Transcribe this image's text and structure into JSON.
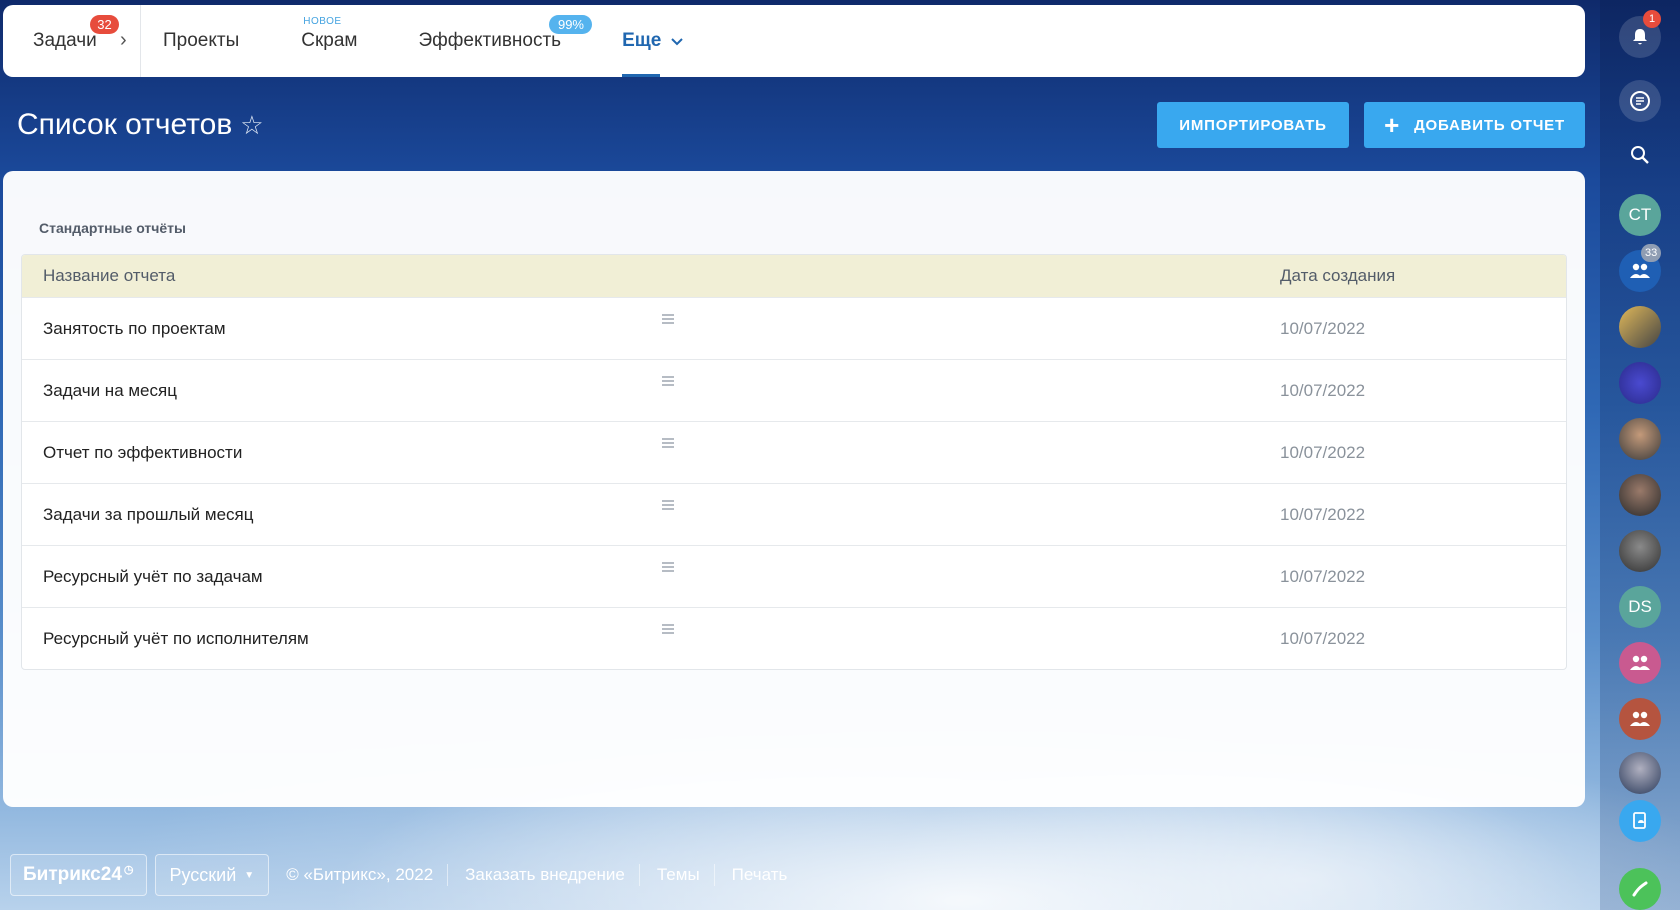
{
  "nav": {
    "tasks": {
      "label": "Задачи",
      "badge": "32"
    },
    "projects": {
      "label": "Проекты"
    },
    "scrum": {
      "label": "Скрам",
      "tag": "НОВОЕ"
    },
    "efficiency": {
      "label": "Эффективность",
      "badge": "99%"
    },
    "more": {
      "label": "Еще"
    }
  },
  "page": {
    "title": "Список отчетов",
    "import_label": "ИМПОРТИРОВАТЬ",
    "add_label": "ДОБАВИТЬ ОТЧЕТ"
  },
  "reports": {
    "section_title": "Стандартные отчёты",
    "columns": {
      "name": "Название отчета",
      "date": "Дата создания"
    },
    "rows": [
      {
        "name": "Занятость по проектам",
        "date": "10/07/2022"
      },
      {
        "name": "Задачи на месяц",
        "date": "10/07/2022"
      },
      {
        "name": "Отчет по эффективности",
        "date": "10/07/2022"
      },
      {
        "name": "Задачи за прошлый месяц",
        "date": "10/07/2022"
      },
      {
        "name": "Ресурсный учёт по задачам",
        "date": "10/07/2022"
      },
      {
        "name": "Ресурсный учёт по исполнителям",
        "date": "10/07/2022"
      }
    ]
  },
  "footer": {
    "brand": "Битрикс24",
    "language": "Русский",
    "copyright": "© «Битрикс», 2022",
    "order": "Заказать внедрение",
    "themes": "Темы",
    "print": "Печать"
  },
  "sidebar": {
    "notifications_badge": "1",
    "avatar_ct": "CT",
    "group_chat_badge": "33",
    "avatar_ds": "DS"
  },
  "colors": {
    "accent": "#39a8ef",
    "active_nav": "#2067b0",
    "badge_red": "#e74c3c",
    "table_header": "#f1efd6"
  }
}
